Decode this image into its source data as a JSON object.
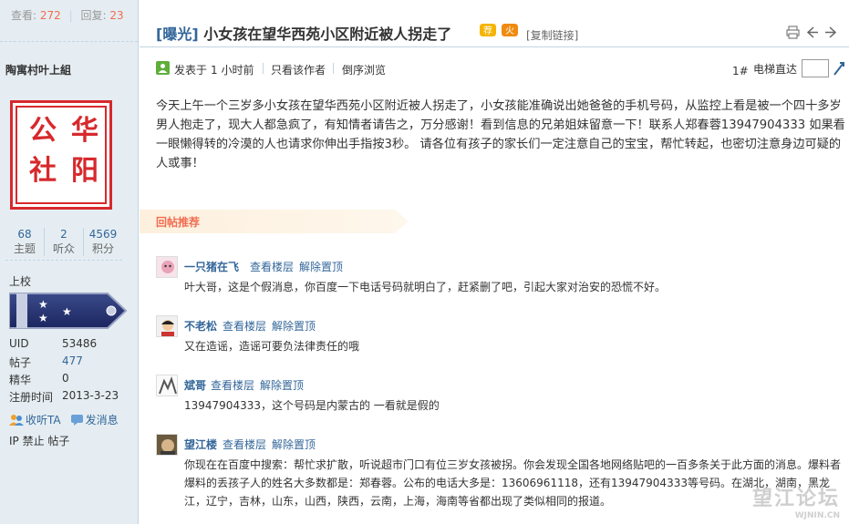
{
  "sidebar": {
    "views_label": "查看:",
    "views": "272",
    "replies_label": "回复:",
    "replies": "23",
    "username": "陶寓村叶上組",
    "avatar_chars": [
      "公",
      "华",
      "社",
      "阳"
    ],
    "counts": [
      {
        "value": "68",
        "label": "主题"
      },
      {
        "value": "2",
        "label": "听众"
      },
      {
        "value": "4569",
        "label": "积分"
      }
    ],
    "rank": "上校",
    "profile": [
      {
        "key": "UID",
        "value": "53486"
      },
      {
        "key": "帖子",
        "value": "477"
      },
      {
        "key": "精华",
        "value": "0"
      },
      {
        "key": "注册时间",
        "value": "2013-3-23"
      }
    ],
    "follow_label": "收听TA",
    "message_label": "发消息",
    "ip_ban_label": "IP 禁止 帖子"
  },
  "thread": {
    "category": "[曝光]",
    "title": "小女孩在望华西苑小区附近被人拐走了",
    "copy_link": "[复制链接]",
    "posted_label": "发表于",
    "posted_time": "1 小时前",
    "only_author": "只看该作者",
    "reverse_order": "倒序浏览",
    "floor": "1#",
    "goto_floor": "电梯直达",
    "content": "今天上午一个三岁多小女孩在望华西苑小区附近被人拐走了，小女孩能准确说出她爸爸的手机号码，从监控上看是被一个四十多岁男人抱走了，现大人都急疯了，有知情者请告之，万分感谢！看到信息的兄弟姐妹留意一下！联系人郑春蓉13947904333 如果看一眼懒得转的冷漠的人也请求你伸出手指按3秒。 请各位有孩子的家长们一定注意自己的宝宝，帮忙转起，也密切注意身边可疑的人或事！"
  },
  "recommend_label": "回帖推荐",
  "replies": [
    {
      "name": "一只猪在飞",
      "view_floor": "查看楼层",
      "unpin": "解除置顶",
      "text": "叶大哥，这是个假消息，你百度一下电话号码就明白了，赶紧删了吧，引起大家对治安的恐慌不好。"
    },
    {
      "name": "不老松",
      "view_floor": "查看楼层",
      "unpin": "解除置顶",
      "text": "又在造谣，造谣可要负法律责任的哦"
    },
    {
      "name": "斌哥",
      "view_floor": "查看楼层",
      "unpin": "解除置顶",
      "text": "13947904333，这个号码是内蒙古的 一看就是假的"
    },
    {
      "name": "望江楼",
      "view_floor": "查看楼层",
      "unpin": "解除置顶",
      "text": "你现在在百度中搜索：帮忙求扩散，听说超市门口有位三岁女孩被拐。你会发现全国各地网络贴吧的一百多条关于此方面的消息。爆料者爆料的丢孩子人的姓名大多数都是：郑春蓉。公布的电话大多是：13606961118，还有13947904333等号码。在湖北，湖南，黑龙江，辽宁，吉林，山东，山西，陕西，云南，上海，海南等省都出现了类似相同的报道。"
    }
  ],
  "watermark": {
    "main": "望江论坛",
    "sub": "WJNIN.CN"
  },
  "colors": {
    "link": "#336699",
    "accent": "#f26c4f",
    "sidebar_bg": "#e5edf2",
    "seal_red": "#d7292c"
  }
}
